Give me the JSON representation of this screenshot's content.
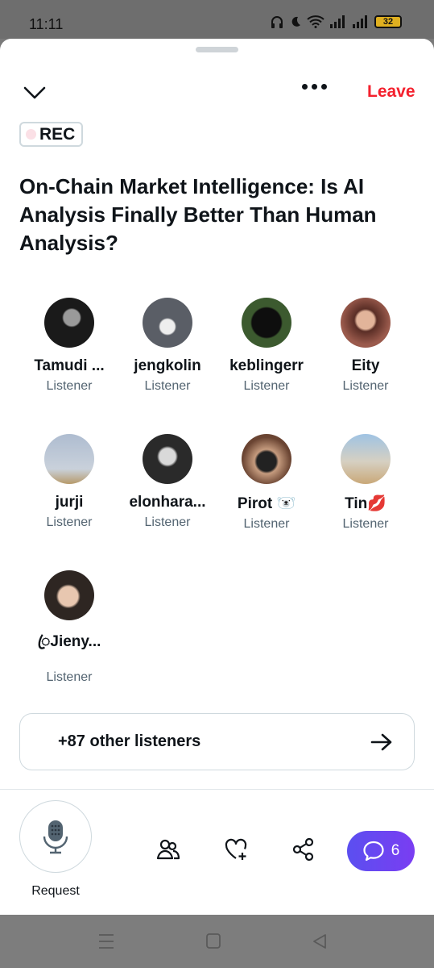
{
  "status_bar": {
    "time": "11:11",
    "battery": "32"
  },
  "header": {
    "leave_label": "Leave"
  },
  "badge": {
    "label": "REC"
  },
  "space": {
    "title": "On-Chain Market Intelligence: Is AI Analysis Finally Better Than Human Analysis?"
  },
  "participants": [
    {
      "name": "Tamudi ...",
      "role": "Listener",
      "avatar_color": "#1a1a1a"
    },
    {
      "name": "jengkolin",
      "role": "Listener",
      "avatar_color": "#5a5e66"
    },
    {
      "name": "keblingerr",
      "role": "Listener",
      "avatar_color": "#2c3a2a"
    },
    {
      "name": "Eity",
      "role": "Listener",
      "avatar_color": "#9a5a4c"
    },
    {
      "name": "jurji",
      "role": "Listener",
      "avatar_color": "#b9c6d6"
    },
    {
      "name": "elonhara...",
      "role": "Listener",
      "avatar_color": "#3a3a3a"
    },
    {
      "name": "Pirot 🐻‍❄️",
      "role": "Listener",
      "avatar_color": "#7a5040"
    },
    {
      "name": "Tin💋",
      "role": "Listener",
      "avatar_color": "#c7b89b"
    },
    {
      "name": "ꦿJieny...",
      "role": "Listener",
      "avatar_color": "#4a3e38"
    }
  ],
  "others": {
    "label": "+87 other listeners"
  },
  "footer": {
    "request_label": "Request",
    "comments_count": "6"
  },
  "colors": {
    "leave": "#f4212e",
    "comments_gradient_start": "#5b4ff0",
    "comments_gradient_end": "#7a3df2"
  },
  "icons": [
    "chevron-down-icon",
    "more-icon",
    "microphone-icon",
    "people-icon",
    "heart-plus-icon",
    "share-icon",
    "chat-bubble-icon",
    "arrow-right-icon"
  ]
}
